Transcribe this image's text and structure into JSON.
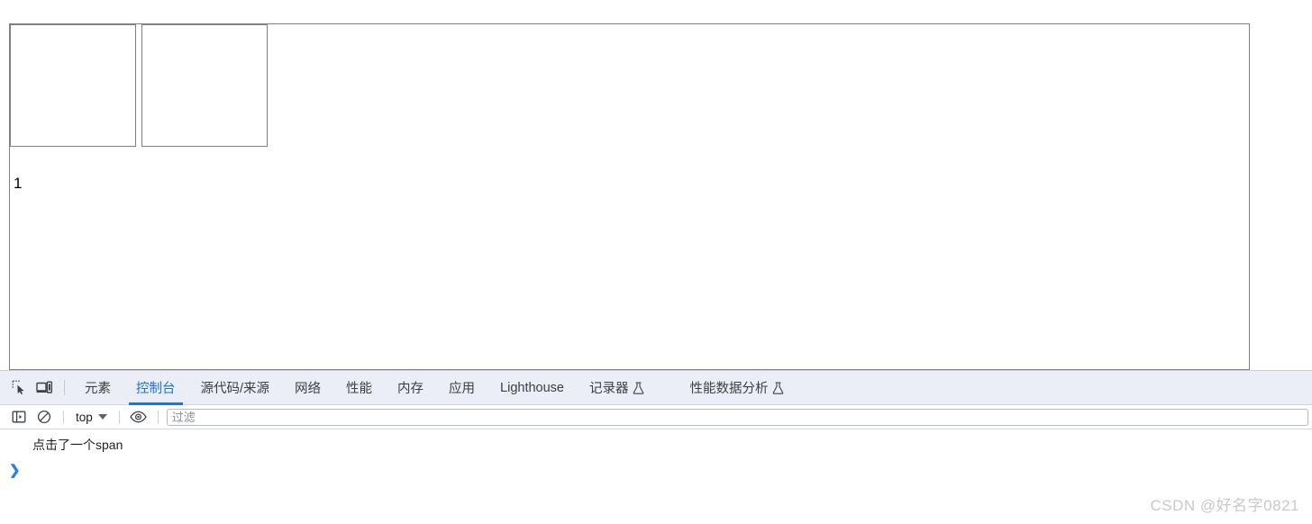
{
  "page": {
    "boxes": [
      {
        "label": ""
      },
      {
        "label": ""
      }
    ],
    "number_text": "1"
  },
  "devtools": {
    "toolbar_icons": [
      {
        "name": "inspect-element-icon",
        "title": "检查元素"
      },
      {
        "name": "device-toolbar-icon",
        "title": "切换设备工具栏"
      }
    ],
    "tabs": [
      {
        "id": "elements",
        "label": "元素",
        "active": false,
        "experimental": false
      },
      {
        "id": "console",
        "label": "控制台",
        "active": true,
        "experimental": false
      },
      {
        "id": "sources",
        "label": "源代码/来源",
        "active": false,
        "experimental": false
      },
      {
        "id": "network",
        "label": "网络",
        "active": false,
        "experimental": false
      },
      {
        "id": "performance",
        "label": "性能",
        "active": false,
        "experimental": false
      },
      {
        "id": "memory",
        "label": "内存",
        "active": false,
        "experimental": false
      },
      {
        "id": "application",
        "label": "应用",
        "active": false,
        "experimental": false
      },
      {
        "id": "lighthouse",
        "label": "Lighthouse",
        "active": false,
        "experimental": false
      },
      {
        "id": "recorder",
        "label": "记录器",
        "active": false,
        "experimental": true
      },
      {
        "id": "performance-insights",
        "label": "性能数据分析",
        "active": false,
        "experimental": true
      }
    ],
    "console_toolbar": {
      "sidebar_toggle": "console-sidebar-icon",
      "clear_console": "clear-console-icon",
      "context_value": "top",
      "eye_icon": "live-expression-eye-icon",
      "filter_placeholder": "过滤",
      "filter_value": ""
    },
    "console_output": [
      {
        "type": "log",
        "text": "点击了一个span"
      }
    ],
    "prompt_symbol": "❯"
  },
  "watermark": {
    "text": "CSDN @好名字0821"
  },
  "colors": {
    "accent": "#1a73e8",
    "tabbar_bg": "#ebeef6",
    "border": "#808080",
    "prompt": "#2e7bf6",
    "watermark": "#c9c9c9"
  }
}
